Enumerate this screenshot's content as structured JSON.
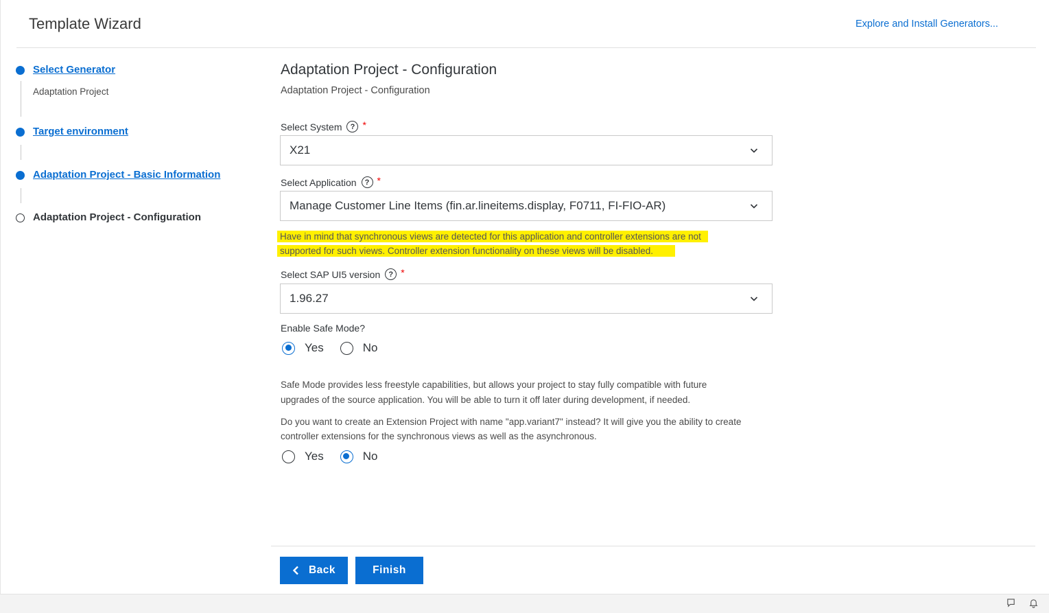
{
  "header": {
    "title": "Template Wizard",
    "link": "Explore and Install Generators..."
  },
  "steps": [
    {
      "label": "Select Generator",
      "sub": "Adaptation Project",
      "state": "done"
    },
    {
      "label": "Target environment",
      "state": "done"
    },
    {
      "label": "Adaptation Project - Basic Information",
      "state": "done"
    },
    {
      "label": "Adaptation Project - Configuration",
      "state": "current"
    }
  ],
  "main": {
    "title": "Adaptation Project - Configuration",
    "subtitle": "Adaptation Project - Configuration",
    "system": {
      "label": "Select System",
      "value": "X21",
      "required": "*"
    },
    "application": {
      "label": "Select Application",
      "value": "Manage Customer Line Items (fin.ar.lineitems.display, F0711, FI-FIO-AR)",
      "required": "*"
    },
    "warning": {
      "line1": "Have in mind that synchronous views are detected for this application and controller extensions are not",
      "line2": "supported for such views. Controller extension functionality on these views will be disabled."
    },
    "ui5": {
      "label": "Select SAP UI5 version",
      "value": "1.96.27",
      "required": "*"
    },
    "safe_mode": {
      "label": "Enable Safe Mode?",
      "yes": "Yes",
      "no": "No",
      "selected": "Yes",
      "info_line1": "Safe Mode provides less freestyle capabilities, but allows your project to stay fully compatible with future",
      "info_line2": "upgrades of the source application. You will be able to turn it off later during development, if needed."
    },
    "extension": {
      "question_line1": "Do you want to create an Extension Project with name \"app.variant7\" instead? It will give you the ability to create",
      "question_line2": "controller extensions for the synchronous views as well as the asynchronous.",
      "yes": "Yes",
      "no": "No",
      "selected": "No"
    }
  },
  "footer": {
    "back": "Back",
    "finish": "Finish"
  },
  "colors": {
    "accent": "#0a6ed1",
    "warning_highlight": "#fff000",
    "required": "#ee0000"
  },
  "icons": [
    "help-icon",
    "chevron-down-icon",
    "chevron-left-icon",
    "feedback-icon",
    "bell-icon"
  ]
}
